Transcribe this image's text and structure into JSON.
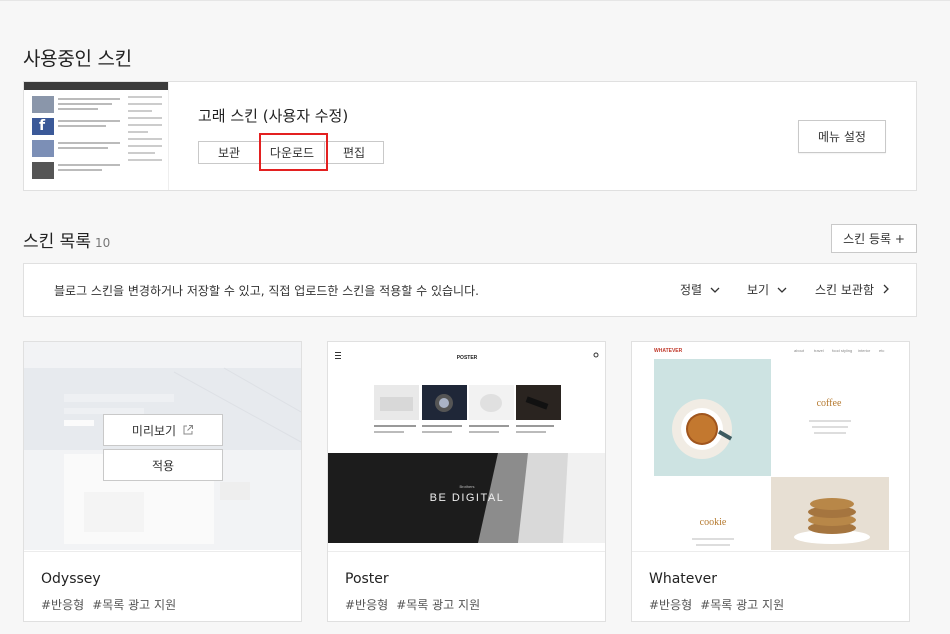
{
  "current": {
    "heading": "사용중인 스킨",
    "skin_name": "고래 스킨 (사용자 수정)",
    "buttons": [
      "보관",
      "다운로드",
      "편집"
    ],
    "menu_button": "메뉴 설정"
  },
  "list": {
    "heading": "스킨 목록",
    "count": "10",
    "register_button": "스킨 등록 +",
    "description": "블로그 스킨을 변경하거나 저장할 수 있고, 직접 업로드한 스킨을 적용할 수 있습니다.",
    "sort_label": "정렬",
    "view_label": "보기",
    "storage_label": "스킨 보관함"
  },
  "cards": [
    {
      "name": "Odyssey",
      "tags": [
        "#반응형",
        "#목록 광고 지원"
      ],
      "preview_button": "미리보기",
      "apply_button": "적용"
    },
    {
      "name": "Poster",
      "tags": [
        "#반응형",
        "#목록 광고 지원"
      ],
      "brand": "POSTER",
      "banner_small": "Brothers",
      "banner_text": "BE DIGITAL"
    },
    {
      "name": "Whatever",
      "tags": [
        "#반응형",
        "#목록 광고 지원"
      ],
      "brand": "WHATEVER",
      "nav": [
        "about",
        "travel",
        "food styling",
        "interior",
        "etc"
      ],
      "coffee": "coffee",
      "cookie": "cookie"
    }
  ],
  "colors": {
    "accent_red": "#e32020",
    "whatever_brand": "#c0392b",
    "coffee_text": "#b5792e"
  }
}
